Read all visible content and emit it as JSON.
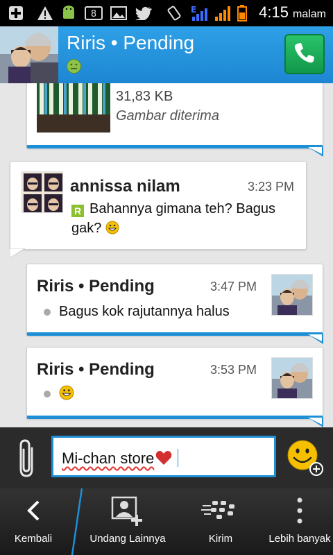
{
  "status_bar": {
    "icons": [
      "add-icon",
      "warning-icon",
      "android-icon",
      "notification-count-icon",
      "image-icon",
      "twitter-icon",
      "vibrate-icon",
      "data-signal-icon",
      "cell-signal-icon",
      "battery-icon"
    ],
    "badge_count": "8",
    "network_letter": "E",
    "time": "4:15",
    "ampm": "malam"
  },
  "header": {
    "title": "Riris • Pending",
    "status_icon": "neutral-face-icon",
    "call_icon": "phone-icon"
  },
  "messages": [
    {
      "file_size": "31,83 KB",
      "file_status": "Gambar diterima"
    },
    {
      "sender": "annissa nilam",
      "time": "3:23 PM",
      "text": "Bahannya gimana teh? Bagus gak?",
      "read_mark": "R"
    },
    {
      "sender": "Riris • Pending",
      "time": "3:47 PM",
      "text": "Bagus kok rajutannya halus"
    },
    {
      "sender": "Riris • Pending",
      "time": "3:53 PM",
      "text": ""
    }
  ],
  "composer": {
    "value": "Mi-chan store",
    "attach_icon": "paperclip-icon",
    "emoji_icon": "smiley-add-icon"
  },
  "nav": [
    {
      "label": "Kembali",
      "icon": "back-icon"
    },
    {
      "label": "Undang Lainnya",
      "icon": "add-contact-icon"
    },
    {
      "label": "Kirim",
      "icon": "bbm-send-icon"
    },
    {
      "label": "Lebih banyak",
      "icon": "more-icon"
    }
  ],
  "colors": {
    "accent": "#1e8fd6",
    "header": "#1d86d3",
    "call_green": "#12974a",
    "emoji_yellow": "#f6c000"
  }
}
